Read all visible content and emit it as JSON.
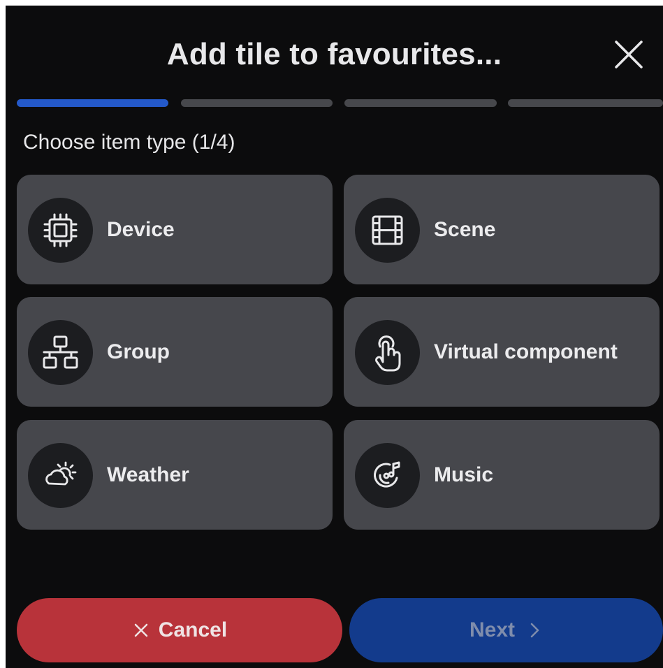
{
  "dialog": {
    "title": "Add tile to favourites...",
    "close_icon": "close-x-icon"
  },
  "stepper": {
    "current_step": 1,
    "total_steps": 4,
    "colors": {
      "active": "#2459c9",
      "inactive": "#47484c"
    }
  },
  "subtitle": "Choose item type (1/4)",
  "item_types": [
    {
      "label": "Device",
      "icon": "chip-icon"
    },
    {
      "label": "Scene",
      "icon": "film-icon"
    },
    {
      "label": "Group",
      "icon": "network-group-icon"
    },
    {
      "label": "Virtual component",
      "icon": "tap-finger-icon"
    },
    {
      "label": "Weather",
      "icon": "cloud-sun-icon"
    },
    {
      "label": "Music",
      "icon": "music-disc-icon"
    }
  ],
  "buttons": {
    "cancel": {
      "label": "Cancel",
      "icon": "x-icon",
      "color": "#b8333a"
    },
    "next": {
      "label": "Next",
      "icon": "chevron-right-icon",
      "color": "#133b8c"
    }
  },
  "colors": {
    "background": "#0c0c0d",
    "tile": "#46474c",
    "icon_circle": "#1c1d20"
  }
}
